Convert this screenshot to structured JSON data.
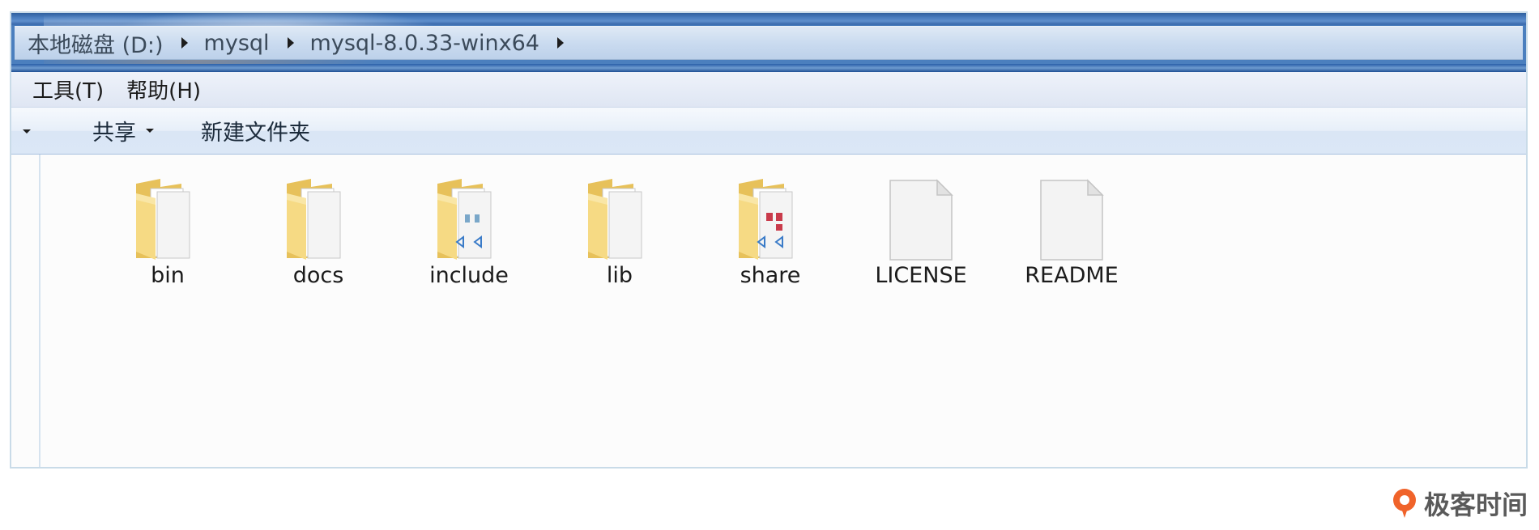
{
  "address_bar": {
    "crumbs": [
      "本地磁盘 (D:)",
      "mysql",
      "mysql-8.0.33-winx64"
    ]
  },
  "menu": {
    "items": [
      "工具(T)",
      "帮助(H)"
    ]
  },
  "command_bar": {
    "share_label": "共享",
    "new_folder_label": "新建文件夹"
  },
  "files": [
    {
      "name": "bin",
      "type": "folder",
      "icon": "folder-icon"
    },
    {
      "name": "docs",
      "type": "folder",
      "icon": "folder-icon"
    },
    {
      "name": "include",
      "type": "folder",
      "icon": "folder-code-icon"
    },
    {
      "name": "lib",
      "type": "folder",
      "icon": "folder-icon"
    },
    {
      "name": "share",
      "type": "folder",
      "icon": "folder-code-icon"
    },
    {
      "name": "LICENSE",
      "type": "file",
      "icon": "document-icon"
    },
    {
      "name": "README",
      "type": "file",
      "icon": "document-icon"
    }
  ],
  "watermark": {
    "text": "极客时间",
    "accent_color": "#f0632a"
  },
  "colors": {
    "folder_yellow": "#f4d77c",
    "folder_dark": "#d9ae45",
    "titlebar_blue": "#3a6aad"
  }
}
